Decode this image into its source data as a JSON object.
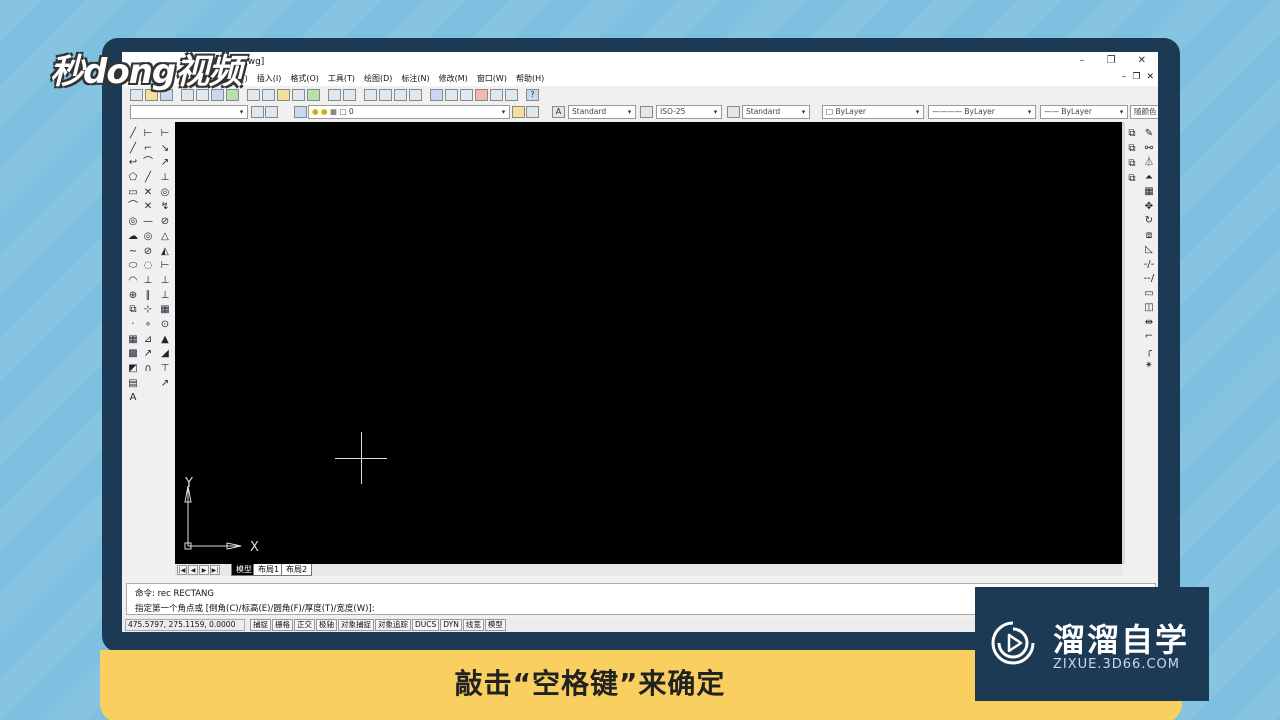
{
  "watermark_left": "秒dong视频",
  "window": {
    "title_fragment": "ng1.dwg]",
    "buttons": [
      "–",
      "❐",
      "✕"
    ]
  },
  "menu": {
    "items": [
      "图(V)",
      "插入(I)",
      "格式(O)",
      "工具(T)",
      "绘图(D)",
      "标注(N)",
      "修改(M)",
      "窗口(W)",
      "帮助(H)"
    ],
    "mdi_buttons": [
      "–",
      "❐",
      "✕"
    ]
  },
  "props": {
    "layer": "0",
    "text_style": "Standard",
    "dim_style": "ISO-25",
    "table_style": "Standard",
    "color": "ByLayer",
    "linetype": "ByLayer",
    "lineweight": "ByLayer",
    "plot_style": "随颜色"
  },
  "ucs": {
    "y": "Y",
    "x": "X"
  },
  "tabs": [
    "模型",
    "布局1",
    "布局2"
  ],
  "command": {
    "line1": "命令: rec RECTANG",
    "line2": "指定第一个角点或 [倒角(C)/标高(E)/圆角(F)/厚度(T)/宽度(W)]:"
  },
  "status": {
    "coords": "475.5797, 275.1159, 0.0000",
    "toggles": [
      "捕捉",
      "栅格",
      "正交",
      "极轴",
      "对象捕捉",
      "对象追踪",
      "DUCS",
      "DYN",
      "线宽",
      "模型"
    ]
  },
  "subtitle": "敲击“空格键”来确定",
  "brand": {
    "name": "溜溜自学",
    "url": "ZIXUE.3D66.COM"
  },
  "colors": {
    "background": "#7ec0e0",
    "frame": "#1d3a55",
    "subtitle_bar": "#f9d060",
    "canvas": "#000000"
  }
}
